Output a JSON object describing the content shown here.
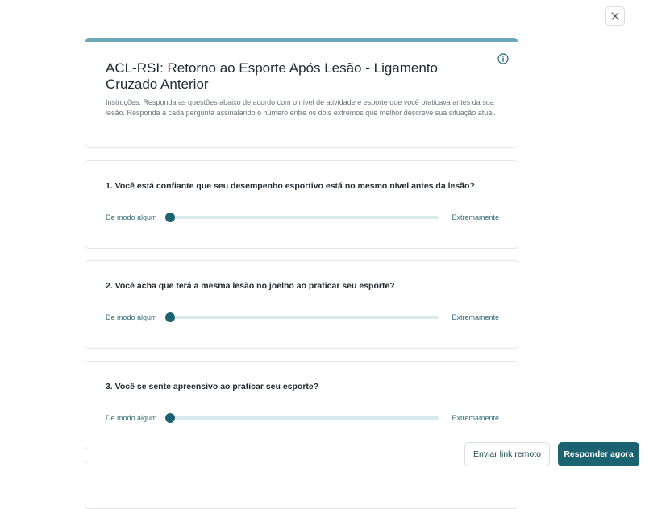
{
  "header": {
    "title": "ACL-RSI: Retorno ao Esporte Após Lesão - Ligamento Cruzado Anterior",
    "instructions": "Instruções: Responda as questões abaixo de acordo com o nível de atividade e esporte que você praticava antes da sua lesão. Responda a cada pergunta assinalando o número entre os dois extremos que melhor descreve sua situação atual."
  },
  "questions": [
    {
      "text": "1. Você está confiante que seu desempenho esportivo está no mesmo nível antes da lesão?",
      "min_label": "De modo algum",
      "max_label": "Extremamente",
      "value": 0
    },
    {
      "text": "2. Você acha que terá a mesma lesão no joelho ao praticar seu esporte?",
      "min_label": "De modo algum",
      "max_label": "Extremamente",
      "value": 0
    },
    {
      "text": "3. Você se sente apreensivo ao praticar seu esporte?",
      "min_label": "De modo algum",
      "max_label": "Extremamente",
      "value": 0
    }
  ],
  "actions": {
    "remote_link_label": "Enviar link remoto",
    "answer_now_label": "Responder agora"
  },
  "icons": {
    "close": "close-icon",
    "info": "info-icon"
  },
  "colors": {
    "accent": "#1c6372",
    "header_bar": "#6aaab5",
    "track": "#d7eaee"
  }
}
